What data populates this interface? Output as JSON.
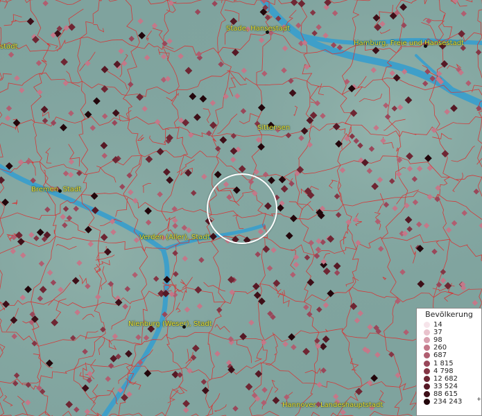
{
  "map": {
    "colors": {
      "land": "#7fa39e",
      "river": "#3f9fc9",
      "boundary": "#d23a3a",
      "label": "#e8e23a"
    },
    "cities": [
      {
        "name": "Stade, Hansestadt"
      },
      {
        "name": "Hamburg, Freie und Hansestadt"
      },
      {
        "name": "Sittensen"
      },
      {
        "name": "Bremen, Stadt"
      },
      {
        "name": "Verden (Aller), Stadt"
      },
      {
        "name": "Nienburg (Weser), Stadt"
      },
      {
        "name": "Hannover, Landeshauptstadt"
      },
      {
        "name": "stadt"
      }
    ]
  },
  "legend": {
    "title": "Bevölkerung",
    "entries": [
      {
        "label": "14",
        "color": "#f6e4ea"
      },
      {
        "label": "37",
        "color": "#e9c3cd"
      },
      {
        "label": "98",
        "color": "#d8a0ae"
      },
      {
        "label": "260",
        "color": "#c47889"
      },
      {
        "label": "687",
        "color": "#b05e70"
      },
      {
        "label": "1 815",
        "color": "#99475a"
      },
      {
        "label": "4 798",
        "color": "#843645"
      },
      {
        "label": "12 682",
        "color": "#6e2633"
      },
      {
        "label": "33 524",
        "color": "#561925"
      },
      {
        "label": "88 615",
        "color": "#3e0f18"
      },
      {
        "label": "234 243",
        "color": "#22060b",
        "plus": "+"
      }
    ]
  }
}
